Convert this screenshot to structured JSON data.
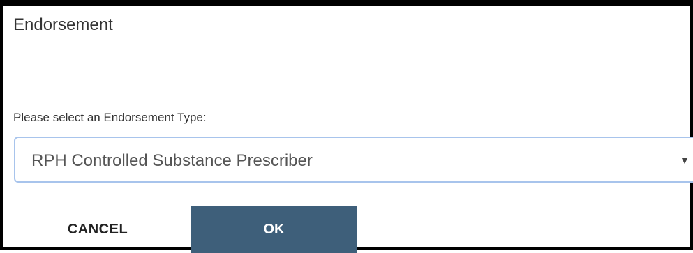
{
  "dialog": {
    "title": "Endorsement",
    "select_label": "Please select an Endorsement Type:",
    "select": {
      "selected_value": "RPH Controlled Substance Prescriber",
      "arrow_icon": "triangle-down-icon",
      "arrow_glyph": "▼"
    },
    "buttons": {
      "cancel_label": "CANCEL",
      "ok_label": "OK"
    },
    "colors": {
      "ok_button": "#3e5f7a",
      "select_border": "#a8c4ec"
    }
  }
}
